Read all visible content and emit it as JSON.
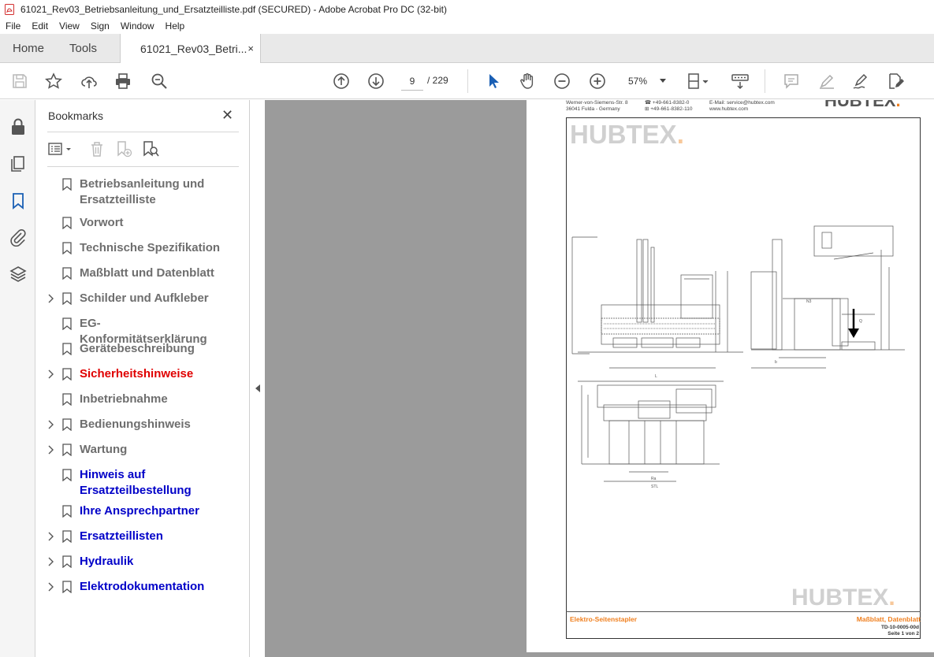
{
  "window": {
    "title": "61021_Rev03_Betriebsanleitung_und_Ersatzteilliste.pdf (SECURED) - Adobe Acrobat Pro DC (32-bit)"
  },
  "menu": [
    "File",
    "Edit",
    "View",
    "Sign",
    "Window",
    "Help"
  ],
  "tabs": {
    "home": "Home",
    "tools": "Tools",
    "doc": "61021_Rev03_Betri...",
    "close": "×"
  },
  "toolbar": {
    "current_page": "9",
    "total_pages": "/ 229",
    "zoom": "57%"
  },
  "bookmarks": {
    "title": "Bookmarks",
    "close": "✕",
    "items": [
      {
        "label": "Betriebsanleitung und Ersatzteilliste",
        "color": "#6e6e6e",
        "expandable": false
      },
      {
        "label": "Vorwort",
        "color": "#6e6e6e",
        "expandable": false
      },
      {
        "label": "Technische Spezifikation",
        "color": "#6e6e6e",
        "expandable": false
      },
      {
        "label": "Maßblatt und Datenblatt",
        "color": "#6e6e6e",
        "expandable": false
      },
      {
        "label": "Schilder und Aufkleber",
        "color": "#6e6e6e",
        "expandable": true
      },
      {
        "label": "EG-Konformitätserklärung",
        "color": "#6e6e6e",
        "expandable": false
      },
      {
        "label": "Gerätebeschreibung",
        "color": "#6e6e6e",
        "expandable": false
      },
      {
        "label": "Sicherheitshinweise",
        "color": "#e00000",
        "expandable": true
      },
      {
        "label": "Inbetriebnahme",
        "color": "#6e6e6e",
        "expandable": false
      },
      {
        "label": "Bedienungshinweis",
        "color": "#6e6e6e",
        "expandable": true
      },
      {
        "label": "Wartung",
        "color": "#6e6e6e",
        "expandable": true
      },
      {
        "label": "Hinweis auf Ersatzteilbestellung",
        "color": "#0000c8",
        "expandable": false
      },
      {
        "label": "Ihre Ansprechpartner",
        "color": "#0000c8",
        "expandable": false
      },
      {
        "label": "Ersatzteillisten",
        "color": "#0000c8",
        "expandable": true
      },
      {
        "label": "Hydraulik",
        "color": "#0000c8",
        "expandable": true
      },
      {
        "label": "Elektrodokumentation",
        "color": "#0000c8",
        "expandable": true
      }
    ]
  },
  "document": {
    "address_line1": "Werner-von-Siemens-Str. 8",
    "address_line2": "36041 Fulda - Germany",
    "phone1": "☎ +49-661-8382-0",
    "phone2": "⊞ +49-661-8382-110",
    "email": "E-Mail: service@hubtex.com",
    "web": "www.hubtex.com",
    "logo_text": "HUBTEX",
    "logo_dot": ".",
    "footer_left": "Elektro-Seitenstapler",
    "footer_right": "Maßblatt, Datenblatt",
    "footer_code": "TD-10-0005-00d",
    "footer_page": "Seite 1 von 2"
  }
}
